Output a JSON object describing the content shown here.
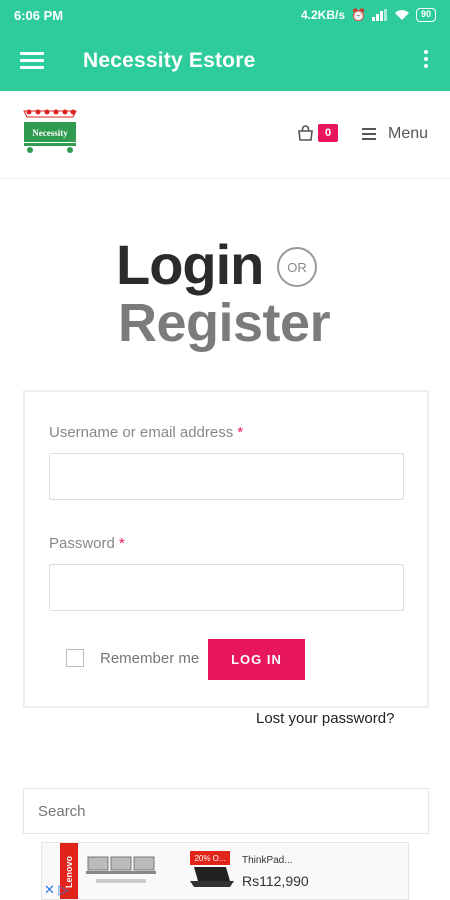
{
  "status_bar": {
    "time": "6:06 PM",
    "network_speed": "4.2KB/s",
    "battery": "90",
    "icons": [
      "alarm-icon",
      "sim-icon",
      "signal-icon",
      "wifi-icon",
      "battery-icon"
    ]
  },
  "app_bar": {
    "title": "Necessity Estore",
    "menu_icon": "hamburger-icon",
    "overflow_icon": "more-vert-icon",
    "color": "#2ecc9a"
  },
  "site_header": {
    "logo_text": "Necessity",
    "cart_count": "0",
    "menu_label": "Menu",
    "accent": "#e8175d"
  },
  "auth": {
    "login_heading": "Login",
    "or_label": "OR",
    "register_heading": "Register"
  },
  "login_form": {
    "username_label": "Username or email address",
    "username_value": "",
    "password_label": "Password",
    "password_value": "",
    "required_mark": "*",
    "remember_label": "Remember me",
    "remember_checked": false,
    "login_button": "LOG IN",
    "lost_password": "Lost your password?"
  },
  "search": {
    "placeholder": "Search"
  },
  "ad": {
    "brand": "Lenovo",
    "deal_tag": "20% O...",
    "product": "ThinkPad...",
    "price": "Rs112,990"
  }
}
